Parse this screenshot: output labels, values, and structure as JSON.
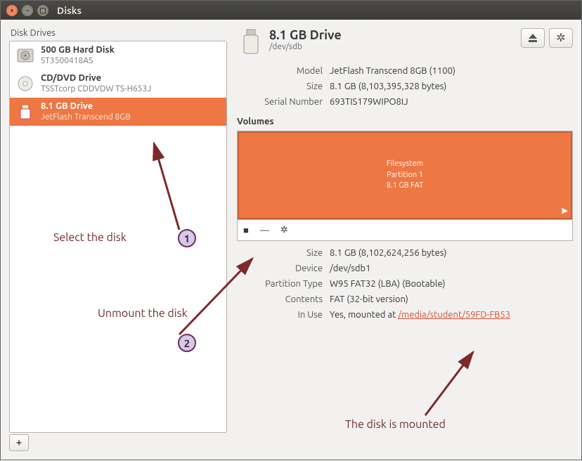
{
  "window": {
    "title": "Disks"
  },
  "sidebar": {
    "header": "Disk Drives",
    "items": [
      {
        "title": "500 GB Hard Disk",
        "subtitle": "ST3500418AS"
      },
      {
        "title": "CD/DVD Drive",
        "subtitle": "TSSTcorp CDDVDW TS-H653J"
      },
      {
        "title": "8.1 GB Drive",
        "subtitle": "JetFlash Transcend 8GB"
      }
    ],
    "add_label": "+"
  },
  "detail": {
    "title": "8.1 GB Drive",
    "device": "/dev/sdb",
    "rows": {
      "model_label": "Model",
      "model": "JetFlash Transcend 8GB (1100)",
      "size_label": "Size",
      "size": "8.1 GB (8,103,395,328 bytes)",
      "serial_label": "Serial Number",
      "serial": "693TIS179WIPO8IJ"
    },
    "volumes_header": "Volumes",
    "partition": {
      "l1": "Filesystem",
      "l2": "Partition 1",
      "l3": "8.1 GB FAT"
    },
    "toolbar": {
      "stop": "■",
      "minus": "—",
      "gear": "✲"
    },
    "vol_rows": {
      "size_label": "Size",
      "size": "8.1 GB (8,102,624,256 bytes)",
      "device_label": "Device",
      "device": "/dev/sdb1",
      "ptype_label": "Partition Type",
      "ptype": "W95 FAT32 (LBA) (Bootable)",
      "contents_label": "Contents",
      "contents": "FAT (32-bit version)",
      "inuse_label": "In Use",
      "inuse_prefix": "Yes, mounted at ",
      "inuse_link": "/media/student/59FD-FB53"
    }
  },
  "annotations": {
    "a1_text": "Select the disk",
    "a1_num": "1",
    "a2_text": "Unmount the disk",
    "a2_num": "2",
    "a3_text": "The disk is mounted"
  }
}
